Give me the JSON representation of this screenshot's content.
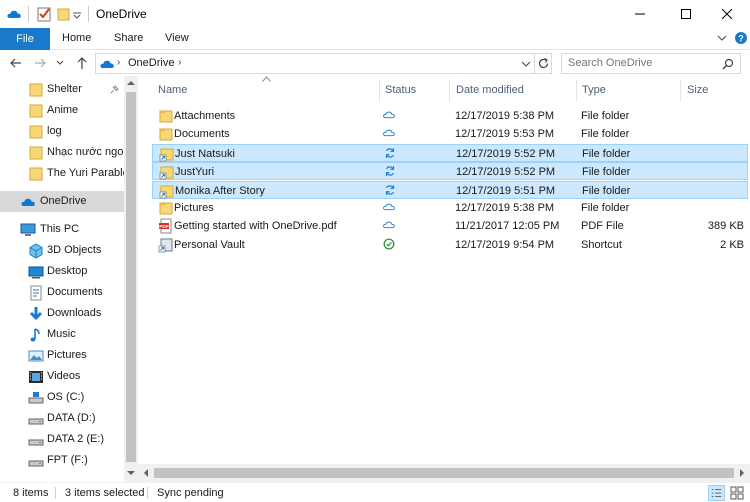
{
  "window": {
    "title": "OneDrive",
    "controls": [
      "minimize",
      "maximize",
      "close"
    ]
  },
  "ribbon": {
    "tabs": [
      "File",
      "Home",
      "Share",
      "View"
    ]
  },
  "address": {
    "path": [
      "OneDrive"
    ],
    "search_placeholder": "Search OneDrive"
  },
  "nav": {
    "quick_access": [
      {
        "label": "Shelter",
        "pinned": true
      },
      {
        "label": "Anime"
      },
      {
        "label": "log"
      },
      {
        "label": "Nhạc nước ngoà"
      },
      {
        "label": "The Yuri Parable"
      }
    ],
    "onedrive": "OneDrive",
    "this_pc": "This PC",
    "this_pc_items": [
      {
        "label": "3D Objects",
        "icon": "3d-objects-icon"
      },
      {
        "label": "Desktop",
        "icon": "desktop-icon"
      },
      {
        "label": "Documents",
        "icon": "documents-icon"
      },
      {
        "label": "Downloads",
        "icon": "downloads-icon"
      },
      {
        "label": "Music",
        "icon": "music-icon"
      },
      {
        "label": "Pictures",
        "icon": "pictures-icon"
      },
      {
        "label": "Videos",
        "icon": "videos-icon"
      },
      {
        "label": "OS (C:)",
        "icon": "os-drive-icon"
      },
      {
        "label": "DATA (D:)",
        "icon": "drive-icon"
      },
      {
        "label": "DATA 2 (E:)",
        "icon": "drive-icon"
      },
      {
        "label": "FPT (F:)",
        "icon": "drive-icon"
      }
    ]
  },
  "columns": [
    "Name",
    "Status",
    "Date modified",
    "Type",
    "Size"
  ],
  "files": [
    {
      "name": "Attachments",
      "status": "cloud",
      "date": "12/17/2019 5:38 PM",
      "type": "File folder",
      "size": "",
      "icon": "folder",
      "selected": false
    },
    {
      "name": "Documents",
      "status": "cloud",
      "date": "12/17/2019 5:53 PM",
      "type": "File folder",
      "size": "",
      "icon": "folder",
      "selected": false
    },
    {
      "name": "Just Natsuki",
      "status": "sync",
      "date": "12/17/2019 5:52 PM",
      "type": "File folder",
      "size": "",
      "icon": "folder-shortcut",
      "selected": true
    },
    {
      "name": "JustYuri",
      "status": "sync",
      "date": "12/17/2019 5:52 PM",
      "type": "File folder",
      "size": "",
      "icon": "folder-shortcut",
      "selected": true
    },
    {
      "name": "Monika After Story",
      "status": "sync",
      "date": "12/17/2019 5:51 PM",
      "type": "File folder",
      "size": "",
      "icon": "folder-shortcut",
      "selected": true
    },
    {
      "name": "Pictures",
      "status": "cloud",
      "date": "12/17/2019 5:38 PM",
      "type": "File folder",
      "size": "",
      "icon": "folder",
      "selected": false
    },
    {
      "name": "Getting started with OneDrive.pdf",
      "status": "cloud",
      "date": "11/21/2017 12:05 PM",
      "type": "PDF File",
      "size": "389 KB",
      "icon": "pdf",
      "selected": false
    },
    {
      "name": "Personal Vault",
      "status": "ok",
      "date": "12/17/2019 9:54 PM",
      "type": "Shortcut",
      "size": "2 KB",
      "icon": "vault-shortcut",
      "selected": false
    }
  ],
  "statusbar": {
    "count": "8 items",
    "selected": "3 items selected",
    "sync": "Sync pending"
  },
  "colors": {
    "accent": "#1979ca",
    "selection_bg": "#cce8ff",
    "selection_border": "#99d1ff",
    "folder": "#f8d775",
    "onedrive_cloud": "#0f78d4",
    "sync_ok": "#2e8b2e"
  }
}
